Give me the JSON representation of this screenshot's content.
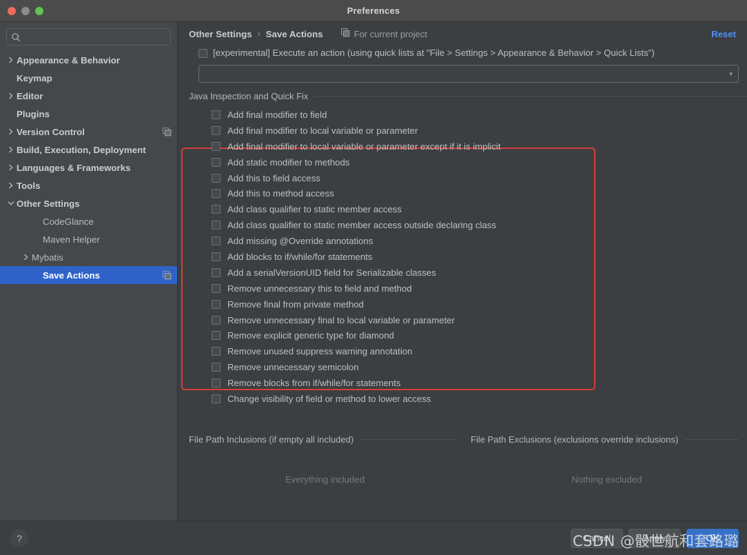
{
  "window": {
    "title": "Preferences",
    "traffic_lights": [
      "close-red",
      "minimize-gray",
      "zoom-green"
    ]
  },
  "sidebar": {
    "search": {
      "value": "",
      "placeholder": ""
    },
    "items": [
      {
        "label": "Appearance & Behavior",
        "level": 0,
        "arrow": "right",
        "bold": true,
        "selected": false,
        "badge": false
      },
      {
        "label": "Keymap",
        "level": 0,
        "arrow": "none",
        "bold": true,
        "selected": false,
        "badge": false
      },
      {
        "label": "Editor",
        "level": 0,
        "arrow": "right",
        "bold": true,
        "selected": false,
        "badge": false
      },
      {
        "label": "Plugins",
        "level": 0,
        "arrow": "none",
        "bold": true,
        "selected": false,
        "badge": false
      },
      {
        "label": "Version Control",
        "level": 0,
        "arrow": "right",
        "bold": true,
        "selected": false,
        "badge": true
      },
      {
        "label": "Build, Execution, Deployment",
        "level": 0,
        "arrow": "right",
        "bold": true,
        "selected": false,
        "badge": false
      },
      {
        "label": "Languages & Frameworks",
        "level": 0,
        "arrow": "right",
        "bold": true,
        "selected": false,
        "badge": false
      },
      {
        "label": "Tools",
        "level": 0,
        "arrow": "right",
        "bold": true,
        "selected": false,
        "badge": false
      },
      {
        "label": "Other Settings",
        "level": 0,
        "arrow": "down",
        "bold": true,
        "selected": false,
        "badge": false
      },
      {
        "label": "CodeGlance",
        "level": 1,
        "arrow": "none",
        "bold": false,
        "selected": false,
        "badge": false
      },
      {
        "label": "Maven Helper",
        "level": 1,
        "arrow": "none",
        "bold": false,
        "selected": false,
        "badge": false
      },
      {
        "label": "Mybatis",
        "level": 1,
        "arrow": "right",
        "bold": false,
        "selected": false,
        "badge": false
      },
      {
        "label": "Save Actions",
        "level": 1,
        "arrow": "none",
        "bold": true,
        "selected": true,
        "badge": true
      }
    ]
  },
  "header": {
    "breadcrumb_root": "Other Settings",
    "breadcrumb_sep": "›",
    "breadcrumb_current": "Save Actions",
    "for_current_project": "For current project",
    "reset": "Reset"
  },
  "experimental": {
    "label": "[experimental] Execute an action (using quick lists at \"File > Settings > Appearance & Behavior > Quick Lists\")",
    "checked": false,
    "combo_value": "",
    "combo_caret": "▾"
  },
  "java_section": {
    "title": "Java Inspection and Quick Fix",
    "checkboxes": [
      {
        "label": "Add final modifier to field",
        "checked": false
      },
      {
        "label": "Add final modifier to local variable or parameter",
        "checked": false
      },
      {
        "label": "Add final modifier to local variable or parameter except if it is implicit",
        "checked": false
      },
      {
        "label": "Add static modifier to methods",
        "checked": false
      },
      {
        "label": "Add this to field access",
        "checked": false
      },
      {
        "label": "Add this to method access",
        "checked": false
      },
      {
        "label": "Add class qualifier to static member access",
        "checked": false
      },
      {
        "label": "Add class qualifier to static member access outside declaring class",
        "checked": false
      },
      {
        "label": "Add missing @Override annotations",
        "checked": false
      },
      {
        "label": "Add blocks to if/while/for statements",
        "checked": false
      },
      {
        "label": "Add a serialVersionUID field for Serializable classes",
        "checked": false
      },
      {
        "label": "Remove unnecessary this to field and method",
        "checked": false
      },
      {
        "label": "Remove final from private method",
        "checked": false
      },
      {
        "label": "Remove unnecessary final to local variable or parameter",
        "checked": false
      },
      {
        "label": "Remove explicit generic type for diamond",
        "checked": false
      },
      {
        "label": "Remove unused suppress warning annotation",
        "checked": false
      },
      {
        "label": "Remove unnecessary semicolon",
        "checked": false
      },
      {
        "label": "Remove blocks from if/while/for statements",
        "checked": false
      },
      {
        "label": "Change visibility of field or method to lower access",
        "checked": false
      }
    ]
  },
  "paths": {
    "inclusions_title": "File Path Inclusions (if empty all included)",
    "inclusions_empty": "Everything included",
    "exclusions_title": "File Path Exclusions (exclusions override inclusions)",
    "exclusions_empty": "Nothing excluded"
  },
  "footer": {
    "help": "?",
    "cancel": "Cancel",
    "apply": "Apply",
    "ok": "OK"
  },
  "watermark": "CSDN @骰世航和套路璐",
  "colors": {
    "window_bg": "#3c3f41",
    "sidebar_bg": "#45484a",
    "titlebar_bg": "#4b4b4b",
    "accent_blue": "#2f63ca",
    "link_blue": "#4b8ff7",
    "highlight_red": "#d2413a",
    "primary_button": "#3671c7"
  }
}
